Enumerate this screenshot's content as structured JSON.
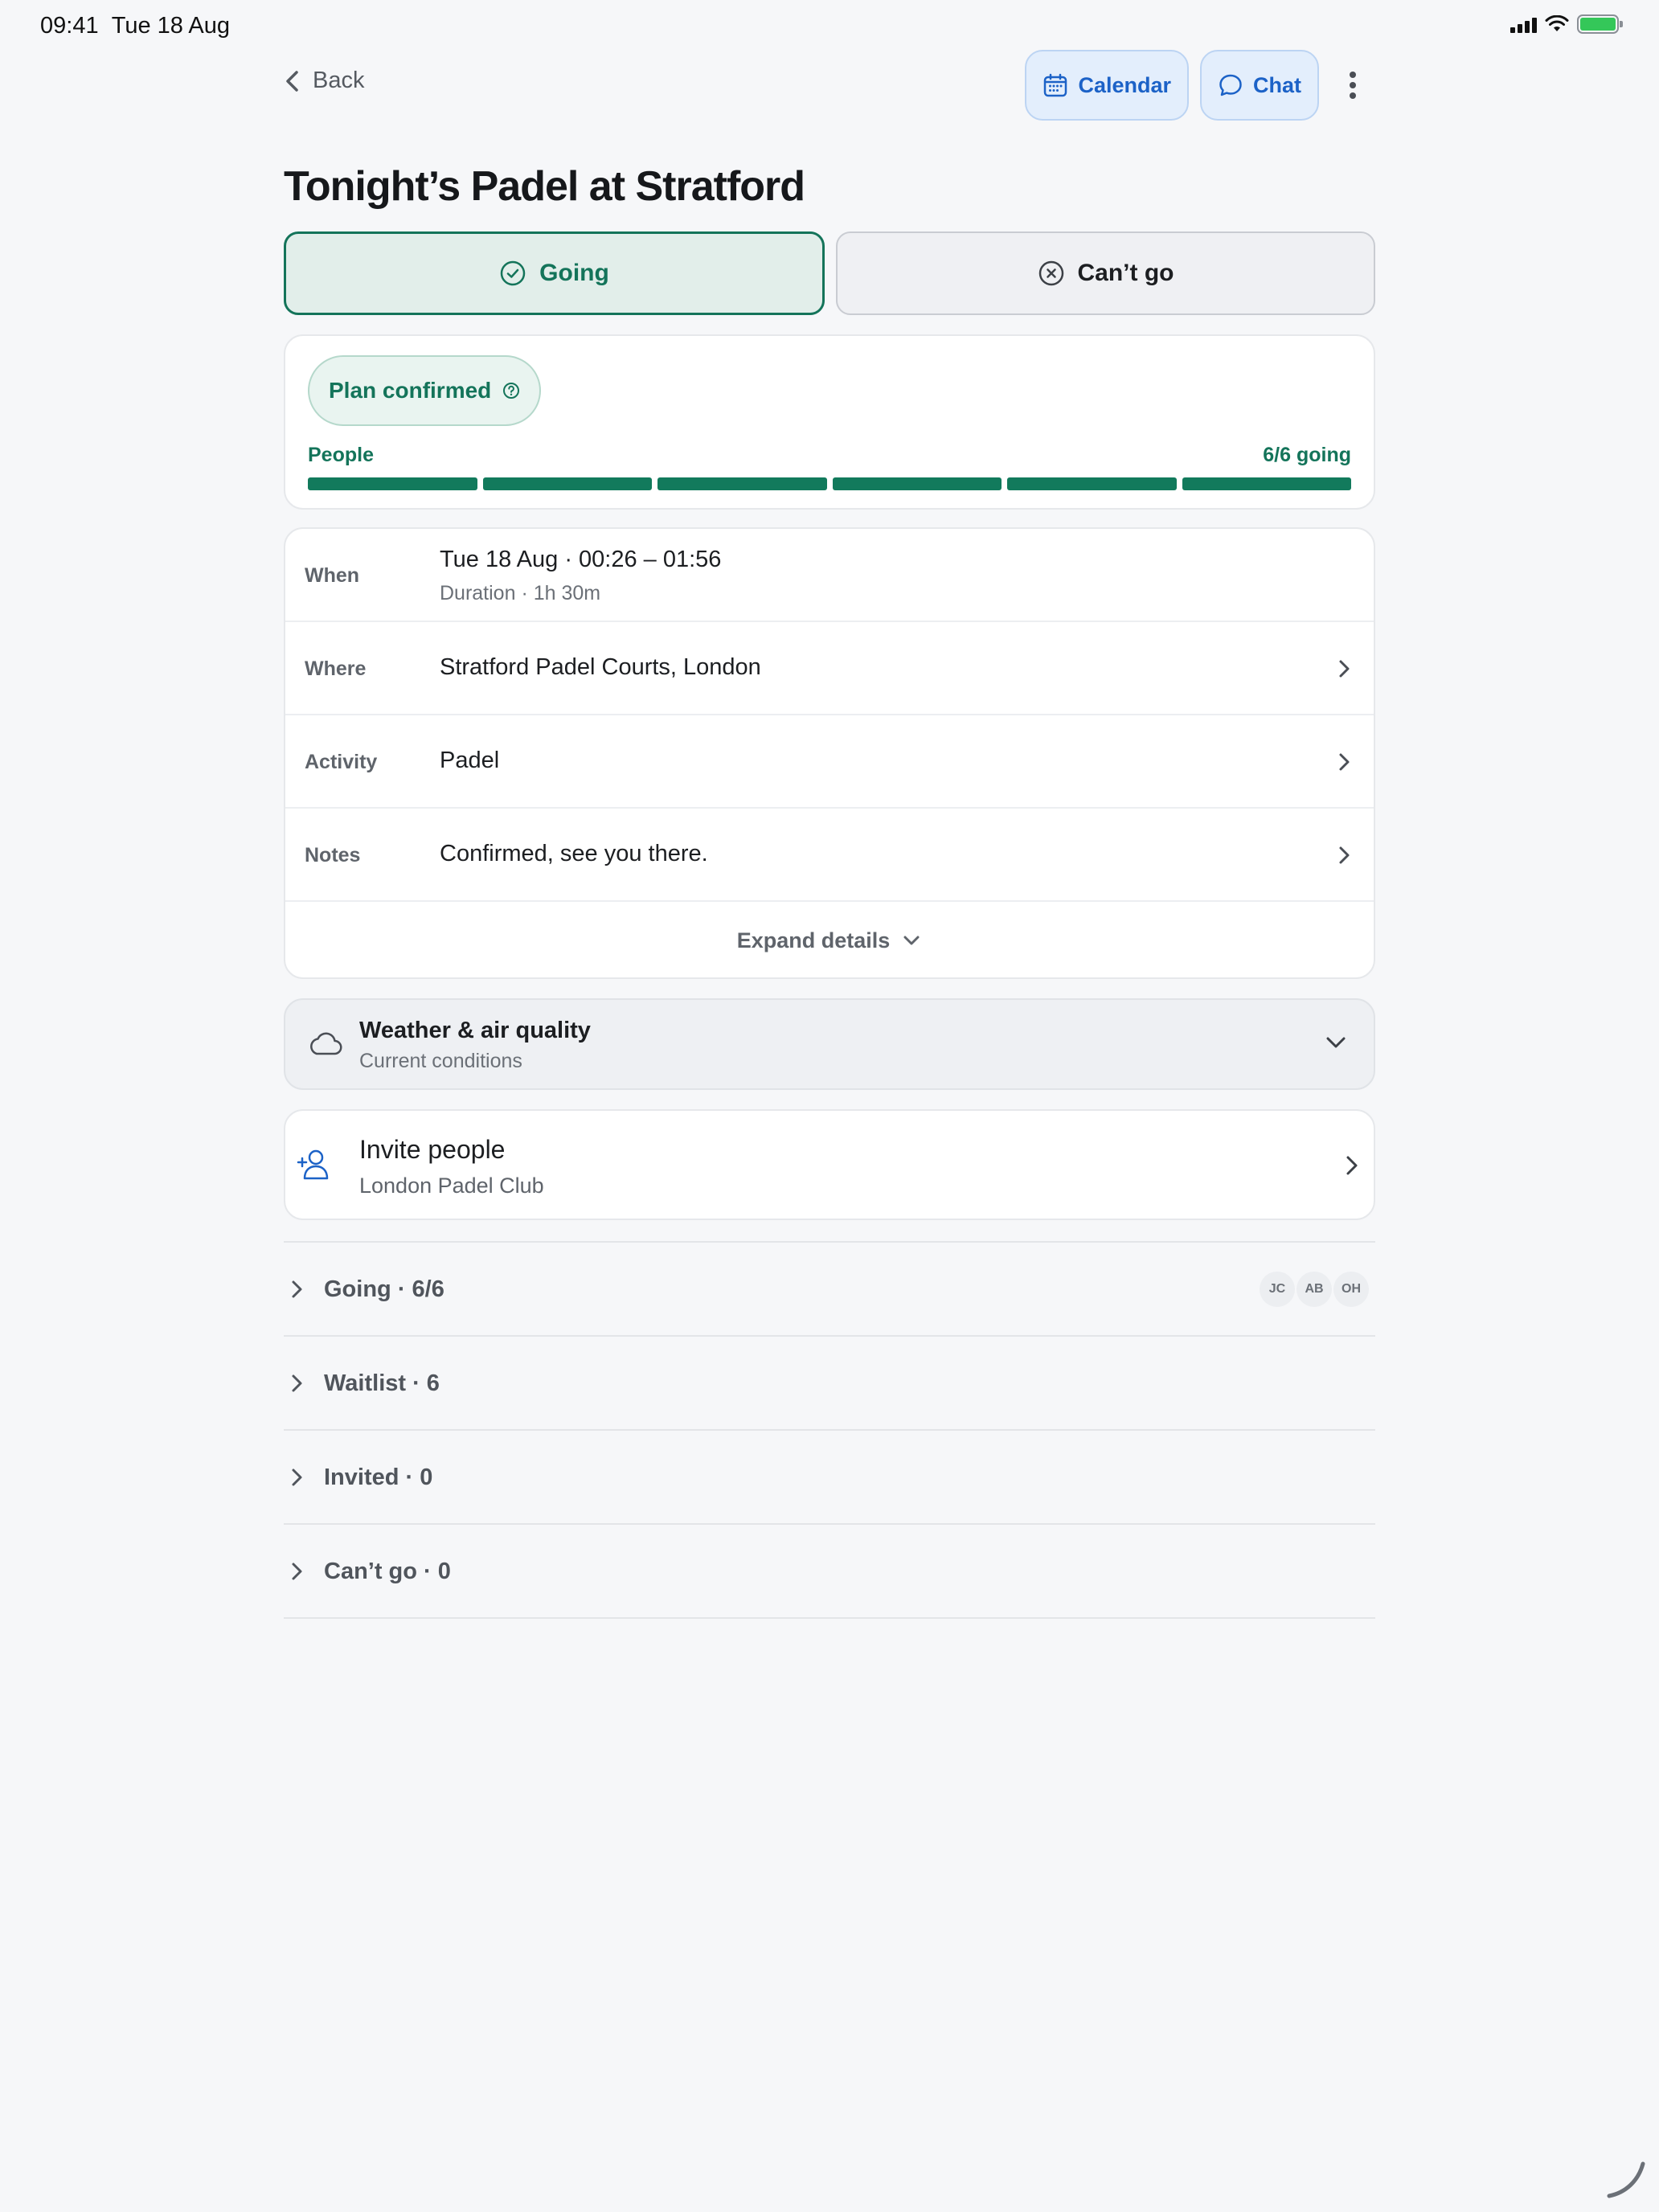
{
  "status_bar": {
    "time": "09:41",
    "date": "Tue 18 Aug"
  },
  "nav": {
    "back_label": "Back",
    "calendar_label": "Calendar",
    "chat_label": "Chat"
  },
  "title": "Tonight’s Padel at Stratford",
  "rsvp": {
    "going_label": "Going",
    "cant_go_label": "Can’t go",
    "selected": "going"
  },
  "plan": {
    "status_label": "Plan confirmed",
    "people_label": "People",
    "going_count_text": "6/6 going",
    "going": 6,
    "capacity": 6
  },
  "details": {
    "when": {
      "label": "When",
      "value": "Tue 18 Aug · 00:26 – 01:56",
      "sub": "Duration · 1h 30m"
    },
    "where": {
      "label": "Where",
      "value": "Stratford Padel Courts, London"
    },
    "activity": {
      "label": "Activity",
      "value": "Padel"
    },
    "notes": {
      "label": "Notes",
      "value": "Confirmed, see you there."
    },
    "expand_label": "Expand details"
  },
  "weather": {
    "title": "Weather & air quality",
    "subtitle": "Current conditions"
  },
  "invite": {
    "title": "Invite people",
    "subtitle": "London Padel Club"
  },
  "sections": [
    {
      "label": "Going · 6/6",
      "avatars": [
        "JC",
        "AB",
        "OH"
      ]
    },
    {
      "label": "Waitlist · 6"
    },
    {
      "label": "Invited · 0"
    },
    {
      "label": "Can’t go · 0"
    }
  ],
  "colors": {
    "brand_green": "#14745a",
    "accent_blue": "#1c62c7",
    "background": "#f6f7f9"
  }
}
